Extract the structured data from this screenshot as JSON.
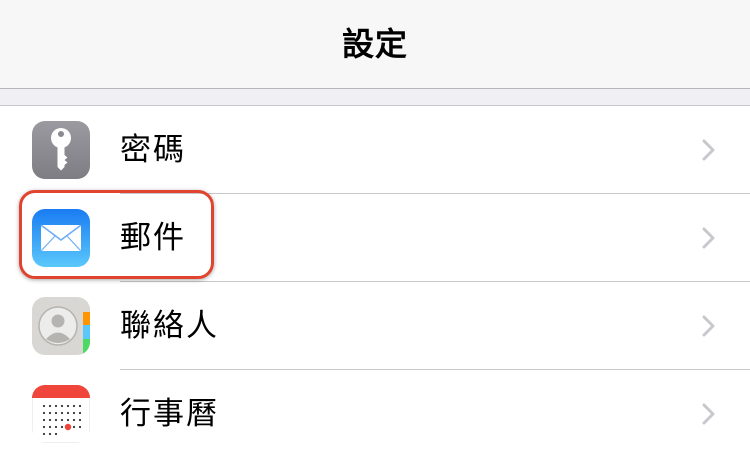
{
  "navbar": {
    "title": "設定"
  },
  "settings": {
    "items": [
      {
        "label": "密碼",
        "icon": "key-icon"
      },
      {
        "label": "郵件",
        "icon": "mail-icon"
      },
      {
        "label": "聯絡人",
        "icon": "contacts-icon"
      },
      {
        "label": "行事曆",
        "icon": "calendar-icon"
      }
    ]
  },
  "colors": {
    "highlight": "#e0432e",
    "chevron": "#c7c7cc",
    "passwords_icon_bg": "#8e8e93",
    "mail_icon_bg": "#2d8ef7"
  }
}
